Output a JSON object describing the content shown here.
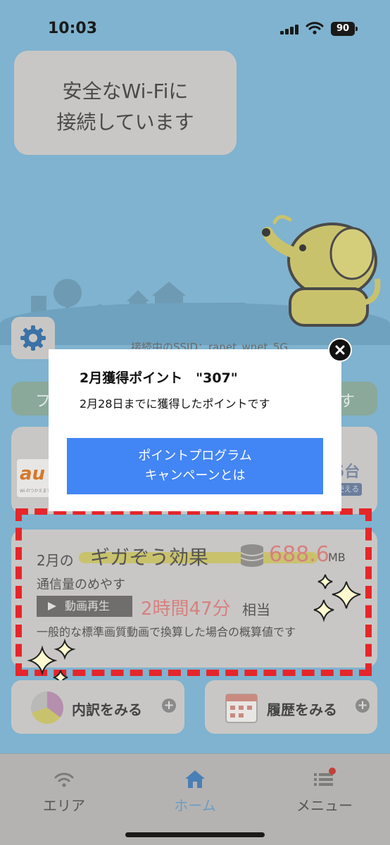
{
  "status_bar": {
    "time": "10:03",
    "battery": "90"
  },
  "connection": {
    "line1": "安全なWi-Fiに",
    "line2": "接続しています"
  },
  "ssid": "接続中のSSID：ranet_wnet_5G",
  "green_banner": {
    "left_text": "フ",
    "right_text": "す"
  },
  "au_card": {
    "logo_text": "au",
    "logo_small": "Wi-Fiつかえます",
    "count_text": "5台",
    "count_badge": "使える"
  },
  "giga_card": {
    "month": "2月の",
    "title": "ギガぞう効果",
    "value": "688.6",
    "unit": "MB",
    "subtitle": "通信量のめやす",
    "tag": "動画再生",
    "time_value": "2時間47分",
    "equiv": "相当",
    "note": "一般的な標準画質動画で換算した場合の概算値です"
  },
  "buttons": {
    "breakdown": "内訳をみる",
    "history": "履歴をみる",
    "plus": "+"
  },
  "tabs": [
    {
      "label": "エリア",
      "icon": "wifi-icon"
    },
    {
      "label": "ホーム",
      "icon": "home-icon"
    },
    {
      "label": "メニュー",
      "icon": "menu-list-icon"
    }
  ],
  "popup": {
    "title": "2月獲得ポイント　\"307\"",
    "description": "2月28日までに獲得したポイントです",
    "button_line1": "ポイントプログラム",
    "button_line2": "キャンペーンとは"
  },
  "colors": {
    "accent_blue": "#4285f4",
    "highlight_red": "#e5262a",
    "value_pink": "#d68180",
    "active_tab": "#6c9cc4"
  }
}
